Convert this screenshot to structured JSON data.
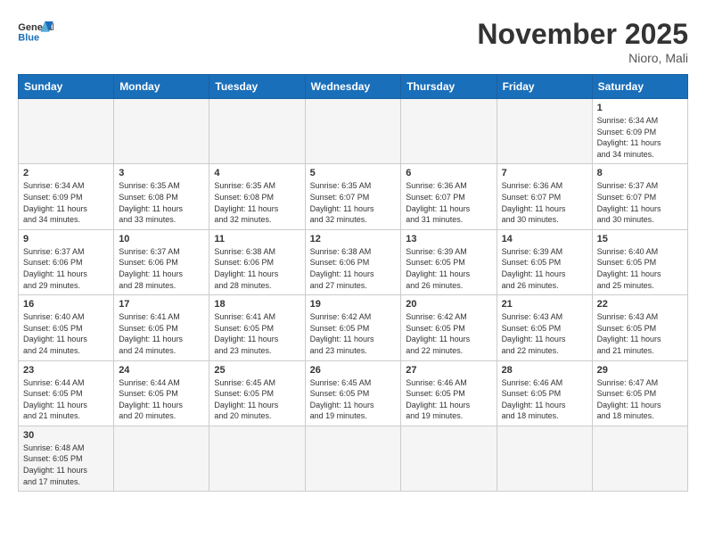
{
  "header": {
    "logo_general": "General",
    "logo_blue": "Blue",
    "month": "November 2025",
    "location": "Nioro, Mali"
  },
  "days_of_week": [
    "Sunday",
    "Monday",
    "Tuesday",
    "Wednesday",
    "Thursday",
    "Friday",
    "Saturday"
  ],
  "weeks": [
    [
      {
        "day": "",
        "info": ""
      },
      {
        "day": "",
        "info": ""
      },
      {
        "day": "",
        "info": ""
      },
      {
        "day": "",
        "info": ""
      },
      {
        "day": "",
        "info": ""
      },
      {
        "day": "",
        "info": ""
      },
      {
        "day": "1",
        "info": "Sunrise: 6:34 AM\nSunset: 6:09 PM\nDaylight: 11 hours\nand 34 minutes."
      }
    ],
    [
      {
        "day": "2",
        "info": "Sunrise: 6:34 AM\nSunset: 6:09 PM\nDaylight: 11 hours\nand 34 minutes."
      },
      {
        "day": "3",
        "info": "Sunrise: 6:35 AM\nSunset: 6:08 PM\nDaylight: 11 hours\nand 33 minutes."
      },
      {
        "day": "4",
        "info": "Sunrise: 6:35 AM\nSunset: 6:08 PM\nDaylight: 11 hours\nand 32 minutes."
      },
      {
        "day": "5",
        "info": "Sunrise: 6:35 AM\nSunset: 6:07 PM\nDaylight: 11 hours\nand 32 minutes."
      },
      {
        "day": "6",
        "info": "Sunrise: 6:36 AM\nSunset: 6:07 PM\nDaylight: 11 hours\nand 31 minutes."
      },
      {
        "day": "7",
        "info": "Sunrise: 6:36 AM\nSunset: 6:07 PM\nDaylight: 11 hours\nand 30 minutes."
      },
      {
        "day": "8",
        "info": "Sunrise: 6:37 AM\nSunset: 6:07 PM\nDaylight: 11 hours\nand 30 minutes."
      }
    ],
    [
      {
        "day": "9",
        "info": "Sunrise: 6:37 AM\nSunset: 6:06 PM\nDaylight: 11 hours\nand 29 minutes."
      },
      {
        "day": "10",
        "info": "Sunrise: 6:37 AM\nSunset: 6:06 PM\nDaylight: 11 hours\nand 28 minutes."
      },
      {
        "day": "11",
        "info": "Sunrise: 6:38 AM\nSunset: 6:06 PM\nDaylight: 11 hours\nand 28 minutes."
      },
      {
        "day": "12",
        "info": "Sunrise: 6:38 AM\nSunset: 6:06 PM\nDaylight: 11 hours\nand 27 minutes."
      },
      {
        "day": "13",
        "info": "Sunrise: 6:39 AM\nSunset: 6:05 PM\nDaylight: 11 hours\nand 26 minutes."
      },
      {
        "day": "14",
        "info": "Sunrise: 6:39 AM\nSunset: 6:05 PM\nDaylight: 11 hours\nand 26 minutes."
      },
      {
        "day": "15",
        "info": "Sunrise: 6:40 AM\nSunset: 6:05 PM\nDaylight: 11 hours\nand 25 minutes."
      }
    ],
    [
      {
        "day": "16",
        "info": "Sunrise: 6:40 AM\nSunset: 6:05 PM\nDaylight: 11 hours\nand 24 minutes."
      },
      {
        "day": "17",
        "info": "Sunrise: 6:41 AM\nSunset: 6:05 PM\nDaylight: 11 hours\nand 24 minutes."
      },
      {
        "day": "18",
        "info": "Sunrise: 6:41 AM\nSunset: 6:05 PM\nDaylight: 11 hours\nand 23 minutes."
      },
      {
        "day": "19",
        "info": "Sunrise: 6:42 AM\nSunset: 6:05 PM\nDaylight: 11 hours\nand 23 minutes."
      },
      {
        "day": "20",
        "info": "Sunrise: 6:42 AM\nSunset: 6:05 PM\nDaylight: 11 hours\nand 22 minutes."
      },
      {
        "day": "21",
        "info": "Sunrise: 6:43 AM\nSunset: 6:05 PM\nDaylight: 11 hours\nand 22 minutes."
      },
      {
        "day": "22",
        "info": "Sunrise: 6:43 AM\nSunset: 6:05 PM\nDaylight: 11 hours\nand 21 minutes."
      }
    ],
    [
      {
        "day": "23",
        "info": "Sunrise: 6:44 AM\nSunset: 6:05 PM\nDaylight: 11 hours\nand 21 minutes."
      },
      {
        "day": "24",
        "info": "Sunrise: 6:44 AM\nSunset: 6:05 PM\nDaylight: 11 hours\nand 20 minutes."
      },
      {
        "day": "25",
        "info": "Sunrise: 6:45 AM\nSunset: 6:05 PM\nDaylight: 11 hours\nand 20 minutes."
      },
      {
        "day": "26",
        "info": "Sunrise: 6:45 AM\nSunset: 6:05 PM\nDaylight: 11 hours\nand 19 minutes."
      },
      {
        "day": "27",
        "info": "Sunrise: 6:46 AM\nSunset: 6:05 PM\nDaylight: 11 hours\nand 19 minutes."
      },
      {
        "day": "28",
        "info": "Sunrise: 6:46 AM\nSunset: 6:05 PM\nDaylight: 11 hours\nand 18 minutes."
      },
      {
        "day": "29",
        "info": "Sunrise: 6:47 AM\nSunset: 6:05 PM\nDaylight: 11 hours\nand 18 minutes."
      }
    ],
    [
      {
        "day": "30",
        "info": "Sunrise: 6:48 AM\nSunset: 6:05 PM\nDaylight: 11 hours\nand 17 minutes."
      },
      {
        "day": "",
        "info": ""
      },
      {
        "day": "",
        "info": ""
      },
      {
        "day": "",
        "info": ""
      },
      {
        "day": "",
        "info": ""
      },
      {
        "day": "",
        "info": ""
      },
      {
        "day": "",
        "info": ""
      }
    ]
  ]
}
